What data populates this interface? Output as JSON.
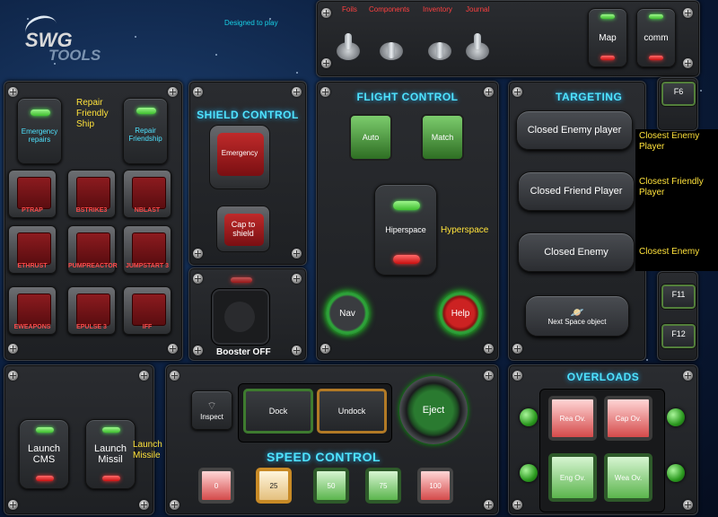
{
  "logo": {
    "line1": "SWG",
    "line2": "TOOLS",
    "tagline": "Designed to play"
  },
  "top": {
    "switches": [
      "Foils",
      "Components",
      "Inventory",
      "Journal"
    ],
    "map": "Map",
    "comm": "comm"
  },
  "repair": {
    "emergency": "Emergency repairs",
    "friendship": "Repair Friendship",
    "note": "Repair Friendly Ship",
    "grid": [
      "PTRAP",
      "BSTRIKE3",
      "NBLAST",
      "ETHRUST",
      "PUMPREACTOR",
      "JUMPSTART 3",
      "EWEAPONS",
      "EPULSE 3",
      "IFF"
    ]
  },
  "shield": {
    "title": "SHIELD CONTROL",
    "emergency": "Emergency",
    "cap": "Cap to shield",
    "booster": "Booster OFF"
  },
  "flight": {
    "title": "FLIGHT CONTROL",
    "auto": "Auto",
    "match": "Match",
    "hyper": "Hiperspace",
    "hyper_note": "Hyperspace",
    "nav": "Nav",
    "help": "Help"
  },
  "targeting": {
    "title": "TARGETING",
    "buttons": [
      "Closed Enemy player",
      "Closed Friend Player",
      "Closed Enemy"
    ],
    "notes": [
      "Closest Enemy Player",
      "Closest Friendly Player",
      "Closest Enemy"
    ],
    "next": "Next Space object"
  },
  "fkeys": [
    "F6",
    "F11",
    "F12"
  ],
  "launch": {
    "cms": "Launch CMS",
    "missil": "Launch Missil",
    "note": "Launch Missile"
  },
  "speed": {
    "title": "SPEED CONTROL",
    "inspect": "Inspect",
    "dock": "Dock",
    "undock": "Undock",
    "eject": "Eject",
    "levels": [
      "0",
      "25",
      "50",
      "75",
      "100"
    ]
  },
  "overloads": {
    "title": "OVERLOADS",
    "buttons": [
      "Rea Ov.",
      "Cap Ov.",
      "Eng Ov.",
      "Wea Ov."
    ]
  },
  "colors": {
    "accent": "#4fe3ff",
    "note": "#ffe23b",
    "green": "#3fbf2f",
    "red": "#c81010"
  }
}
